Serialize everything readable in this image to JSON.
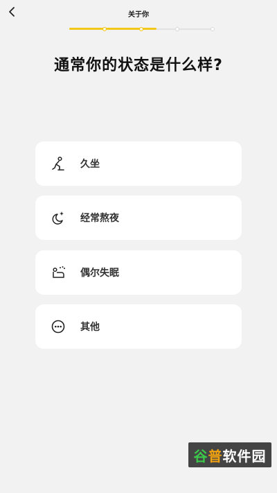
{
  "header": {
    "title": "关于你",
    "back_icon": "chevron-left-icon"
  },
  "progress": {
    "steps_total": 4,
    "steps_completed": 2,
    "fraction": 0.6,
    "accent_color": "#f2c718"
  },
  "question": "通常你的状态是什么样?",
  "options": [
    {
      "label": "久坐",
      "icon": "sitting-person-icon"
    },
    {
      "label": "经常熬夜",
      "icon": "moon-stars-icon"
    },
    {
      "label": "偶尔失眠",
      "icon": "lying-awake-icon"
    },
    {
      "label": "其他",
      "icon": "more-dots-icon"
    }
  ],
  "watermark": {
    "part1": "谷",
    "part2": "普",
    "part3": "软件园"
  }
}
